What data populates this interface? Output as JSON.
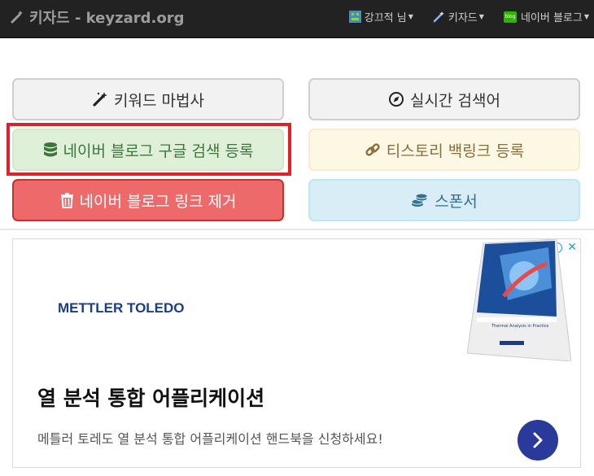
{
  "navbar": {
    "brand": "키자드 - keyzard.org",
    "items": [
      {
        "label": "강끄적 님",
        "icon": "user-avatar-icon"
      },
      {
        "label": "키자드",
        "icon": "magic-wand-icon"
      },
      {
        "label": "네이버 블로그",
        "icon": "blog-icon",
        "badge": "blog"
      }
    ]
  },
  "buttons": {
    "keyword_wizard": "키워드 마법사",
    "realtime_search": "실시간 검색어",
    "naver_google_register": "네이버 블로그 구글 검색 등록",
    "tistory_backlink": "티스토리 백링크 등록",
    "naver_link_remove": "네이버 블로그 링크 제거",
    "sponsor": "스폰서"
  },
  "ad": {
    "logo": "METTLER TOLEDO",
    "headline": "열 분석 통합 어플리케이션",
    "description": "메틀러 토레도 열 분석 통합 어플리케이션 핸드북을 신청하세요!",
    "info_icon": "i",
    "close_icon": "✕",
    "book_title": "Thermal Analysis in Practice"
  },
  "colors": {
    "navbar_bg": "#222222",
    "highlight": "#e0202a",
    "ad_arrow": "#2a3a9a"
  }
}
